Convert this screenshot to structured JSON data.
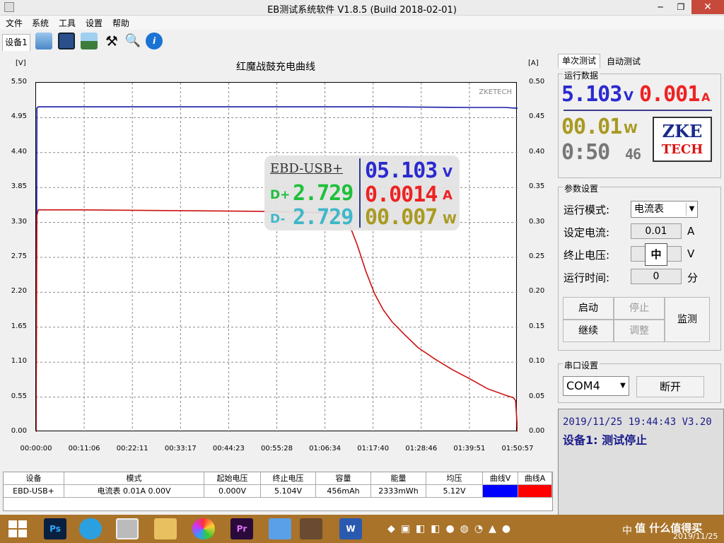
{
  "window": {
    "title": "EB测试系统软件 V1.8.5 (Build 2018-02-01)"
  },
  "menu": [
    "文件",
    "系统",
    "工具",
    "设置",
    "帮助"
  ],
  "toolbar": {
    "device_tab": "设备1"
  },
  "chart": {
    "watermark": "ZKETECH"
  },
  "chart_data": {
    "type": "line",
    "title": "红魔战鼓充电曲线",
    "left_unit": "[V]",
    "right_unit": "[A]",
    "left_ticks": [
      "5.50",
      "4.95",
      "4.40",
      "3.85",
      "3.30",
      "2.75",
      "2.20",
      "1.65",
      "1.10",
      "0.55",
      "0.00"
    ],
    "right_ticks": [
      "0.50",
      "0.45",
      "0.40",
      "0.35",
      "0.30",
      "0.25",
      "0.20",
      "0.15",
      "0.10",
      "0.05",
      "0.00"
    ],
    "x_ticks": [
      "00:00:00",
      "00:11:06",
      "00:22:11",
      "00:33:17",
      "00:44:23",
      "00:55:28",
      "01:06:34",
      "01:17:40",
      "01:28:46",
      "01:39:51",
      "01:50:57"
    ],
    "ylim_left": [
      0,
      5.5
    ],
    "ylim_right": [
      0,
      0.5
    ],
    "xlim_min": [
      0,
      110.95
    ],
    "grid": true,
    "series": [
      {
        "axis": "left",
        "color": "#1a1aa6",
        "x": [
          0,
          0.2,
          0.5,
          10,
          40,
          80,
          100,
          108,
          110.5,
          110.95
        ],
        "y": [
          0,
          5.1,
          5.12,
          5.12,
          5.12,
          5.12,
          5.11,
          5.11,
          5.1,
          5.1
        ]
      },
      {
        "axis": "right",
        "color": "#cc1111",
        "x": [
          0,
          0.2,
          0.5,
          10,
          30,
          50,
          60,
          70,
          72,
          74,
          76,
          78,
          80,
          82,
          85,
          88,
          92,
          96,
          100,
          104,
          108,
          110,
          110.5,
          110.95
        ],
        "y": [
          0,
          0.31,
          0.318,
          0.318,
          0.317,
          0.316,
          0.315,
          0.313,
          0.3,
          0.268,
          0.23,
          0.198,
          0.175,
          0.158,
          0.139,
          0.121,
          0.104,
          0.089,
          0.076,
          0.062,
          0.053,
          0.049,
          0.045,
          0.0
        ]
      }
    ]
  },
  "overlay": {
    "device": "EBD-USB+",
    "d_plus_label": "D+",
    "d_plus_value": "2.729",
    "d_minus_label": "D-",
    "d_minus_value": "2.729",
    "voltage": "05.103",
    "voltage_unit": "V",
    "current": "0.0014",
    "current_unit": "A",
    "power": "00.007",
    "power_unit": "W"
  },
  "table": {
    "headers": [
      "设备",
      "模式",
      "起始电压",
      "终止电压",
      "容量",
      "能量",
      "均压",
      "曲线V",
      "曲线A"
    ],
    "row": [
      "EBD-USB+",
      "电流表 0.01A 0.00V",
      "0.000V",
      "5.104V",
      "456mAh",
      "2333mWh",
      "5.12V"
    ],
    "curve_v_color": "#0000ff",
    "curve_a_color": "#ff0000"
  },
  "right": {
    "tabs": [
      "单次测试",
      "自动测试"
    ],
    "running_data_title": "运行数据",
    "voltage": "5.103",
    "voltage_unit": "V",
    "current": "0.001",
    "current_unit": "A",
    "power": "00.01",
    "power_unit": "W",
    "time": "0:50",
    "time_sec": "46",
    "logo_top": "ZKE",
    "logo_bottom": "TECH",
    "params_title": "参数设置",
    "mode_label": "运行模式:",
    "mode_value": "电流表",
    "set_current_label": "设定电流:",
    "set_current_value": "0.01",
    "set_current_unit": "A",
    "stop_voltage_label": "终止电压:",
    "stop_voltage_unit": "V",
    "run_time_label": "运行时间:",
    "run_time_value": "0",
    "run_time_unit": "分",
    "ime_popup": "中",
    "btn_start": "启动",
    "btn_stop": "停止",
    "btn_continue": "继续",
    "btn_adjust": "调整",
    "btn_monitor": "监测",
    "serial_title": "串口设置",
    "port_value": "COM4",
    "btn_disconnect": "断开",
    "status_time": "2019/11/25 19:44:43  V3.20",
    "status_msg": "设备1: 测试停止"
  },
  "taskbar": {
    "date": "2019/11/25",
    "watermark": "值 什么值得买",
    "input_method": "中"
  }
}
